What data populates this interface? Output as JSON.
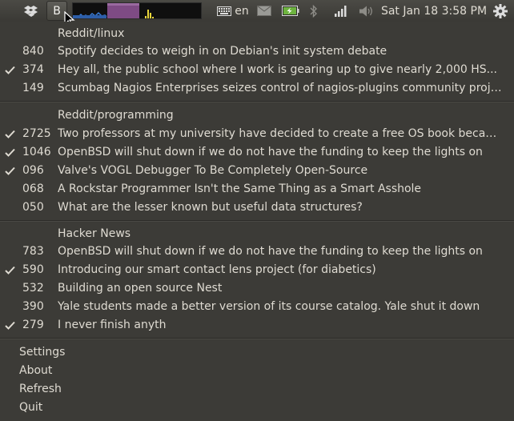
{
  "panel": {
    "indicator_label": "B",
    "language": "en",
    "clock": "Sat Jan 18  3:58 PM",
    "icons": [
      "dropbox-icon",
      "keyboard-icon",
      "mail-icon",
      "battery-icon",
      "bluetooth-icon",
      "network-icon",
      "volume-icon",
      "gear-icon"
    ]
  },
  "sections": [
    {
      "title": "Reddit/linux",
      "items": [
        {
          "count": "840",
          "checked": false,
          "title": "Spotify decides to weigh in on Debian's init system debate"
        },
        {
          "count": "374",
          "checked": true,
          "title": "Hey all, the public school where I work is gearing up to give nearly 2,000 HS..."
        },
        {
          "count": "149",
          "checked": false,
          "title": "Scumbag Nagios Enterprises seizes control of nagios-plugins community project..."
        }
      ]
    },
    {
      "title": "Reddit/programming",
      "items": [
        {
          "count": "2725",
          "checked": true,
          "title": "Two professors at my university have decided to create a free OS book because..."
        },
        {
          "count": "1046",
          "checked": true,
          "title": "OpenBSD will shut down if we do not have the funding to keep the lights on"
        },
        {
          "count": "096",
          "checked": true,
          "title": "Valve's VOGL Debugger To Be Completely Open-Source"
        },
        {
          "count": "068",
          "checked": false,
          "title": "A Rockstar Programmer Isn't the Same Thing as a Smart Asshole"
        },
        {
          "count": "050",
          "checked": false,
          "title": "What are the lesser known but useful data structures?"
        }
      ]
    },
    {
      "title": "Hacker News",
      "items": [
        {
          "count": "783",
          "checked": false,
          "title": "OpenBSD will shut down if we do not have the funding to keep the lights on"
        },
        {
          "count": "590",
          "checked": true,
          "title": "Introducing our smart contact lens project (for diabetics)"
        },
        {
          "count": "532",
          "checked": false,
          "title": "Building an open source Nest"
        },
        {
          "count": "390",
          "checked": false,
          "title": "Yale students made a better version of its course catalog. Yale shut it down"
        },
        {
          "count": "279",
          "checked": true,
          "title": "I never finish anyth"
        }
      ]
    }
  ],
  "actions": {
    "settings": "Settings",
    "about": "About",
    "refresh": "Refresh",
    "quit": "Quit"
  },
  "colors": {
    "background": "#3c3b37",
    "text": "#dfdbd2",
    "sysmon_cpu": "#3a7bd5",
    "sysmon_mem": "#8a4f8e",
    "sysmon_net": "#e8d53b"
  }
}
